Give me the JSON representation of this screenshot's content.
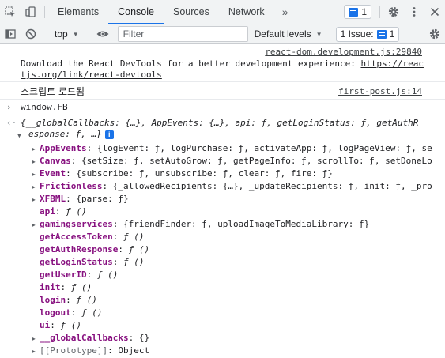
{
  "tabs": {
    "items": [
      "Elements",
      "Console",
      "Sources",
      "Network"
    ],
    "more": "»",
    "messages_count": "1"
  },
  "toolbar": {
    "context": "top",
    "filter_placeholder": "Filter",
    "levels": "Default levels",
    "issues": "1 Issue:",
    "issues_count": "1"
  },
  "console": {
    "devtools_link_src": "react-dom.development.js:29840",
    "devtools_msg_line1": "Download the React DevTools for a better development experience: ",
    "devtools_msg_link1": "https://reac",
    "devtools_msg_link2": "tjs.org/link/react-devtools",
    "script_loaded": "스크립트 로드됨",
    "script_src": "first-post.js:14",
    "input_expr": "window.FB",
    "summary_line1": "{__globalCallbacks: {…}, AppEvents: {…}, api: ƒ, getLoginStatus: ƒ, getAuthR",
    "summary_line2": "esponse: ƒ, …}",
    "properties": [
      {
        "key": "AppEvents",
        "value": "{logEvent: ƒ, logPurchase: ƒ, activateApp: ƒ, logPageView: ƒ, se"
      },
      {
        "key": "Canvas",
        "value": "{setSize: ƒ, setAutoGrow: ƒ, getPageInfo: ƒ, scrollTo: ƒ, setDoneLo"
      },
      {
        "key": "Event",
        "value": "{subscribe: ƒ, unsubscribe: ƒ, clear: ƒ, fire: ƒ}"
      },
      {
        "key": "Frictionless",
        "value": "{_allowedRecipients: {…}, _updateRecipients: ƒ, init: ƒ, _pro"
      },
      {
        "key": "XFBML",
        "value": "{parse: ƒ}"
      },
      {
        "key": "api",
        "value": "ƒ ()"
      },
      {
        "key": "gamingservices",
        "value": "{friendFinder: ƒ, uploadImageToMediaLibrary: ƒ}"
      },
      {
        "key": "getAccessToken",
        "value": "ƒ ()"
      },
      {
        "key": "getAuthResponse",
        "value": "ƒ ()"
      },
      {
        "key": "getLoginStatus",
        "value": "ƒ ()"
      },
      {
        "key": "getUserID",
        "value": "ƒ ()"
      },
      {
        "key": "init",
        "value": "ƒ ()"
      },
      {
        "key": "login",
        "value": "ƒ ()"
      },
      {
        "key": "logout",
        "value": "ƒ ()"
      },
      {
        "key": "ui",
        "value": "ƒ ()"
      },
      {
        "key": "__globalCallbacks",
        "value": "{}"
      },
      {
        "key": "[[Prototype]]",
        "value": "Object"
      }
    ]
  }
}
